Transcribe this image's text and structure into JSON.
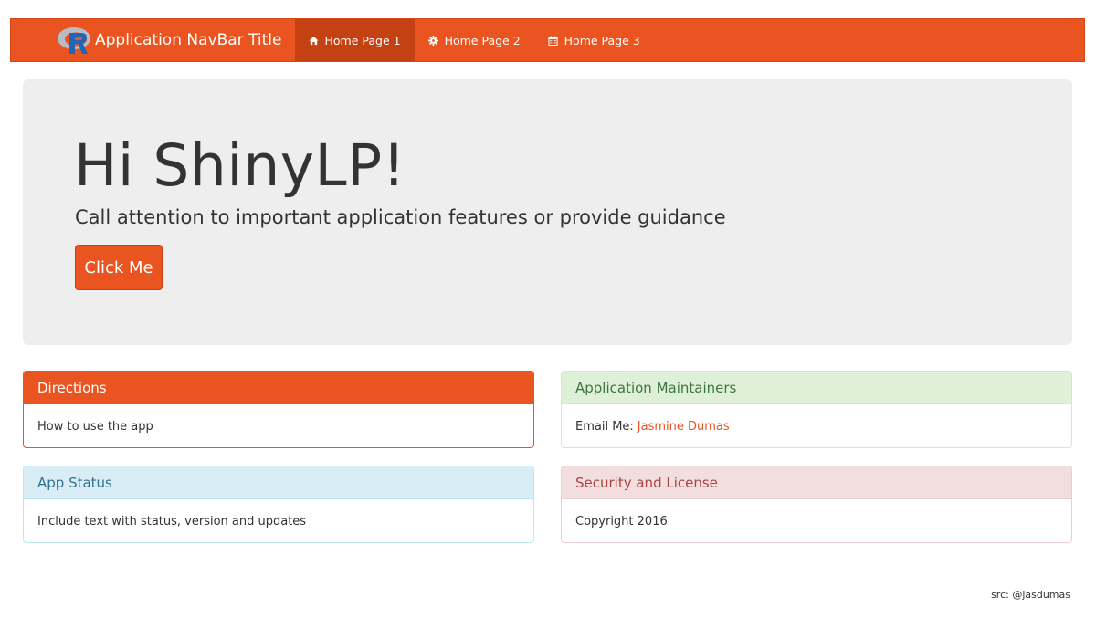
{
  "navbar": {
    "title": "Application NavBar Title",
    "logo_letter": "R",
    "items": [
      {
        "label": "Home Page 1",
        "icon": "home-icon",
        "active": true
      },
      {
        "label": "Home Page 2",
        "icon": "gear-icon",
        "active": false
      },
      {
        "label": "Home Page 3",
        "icon": "calendar-icon",
        "active": false
      }
    ]
  },
  "jumbotron": {
    "title": "Hi ShinyLP!",
    "subtitle": "Call attention to important application features or provide guidance",
    "button_label": "Click Me"
  },
  "panels": {
    "directions": {
      "heading": "Directions",
      "body": "How to use the app"
    },
    "maintainers": {
      "heading": "Application Maintainers",
      "body_prefix": "Email Me:",
      "link_text": "Jasmine Dumas"
    },
    "status": {
      "heading": "App Status",
      "body": "Include text with status, version and updates"
    },
    "security": {
      "heading": "Security and License",
      "body": "Copyright 2016"
    }
  },
  "footer": {
    "source": "src: @jasdumas"
  },
  "colors": {
    "accent": "#e95420",
    "active_nav": "#c34113",
    "jumbotron_bg": "#eeeeee",
    "success_bg": "#dff0d8",
    "info_bg": "#d9edf7",
    "danger_bg": "#f2dede"
  }
}
